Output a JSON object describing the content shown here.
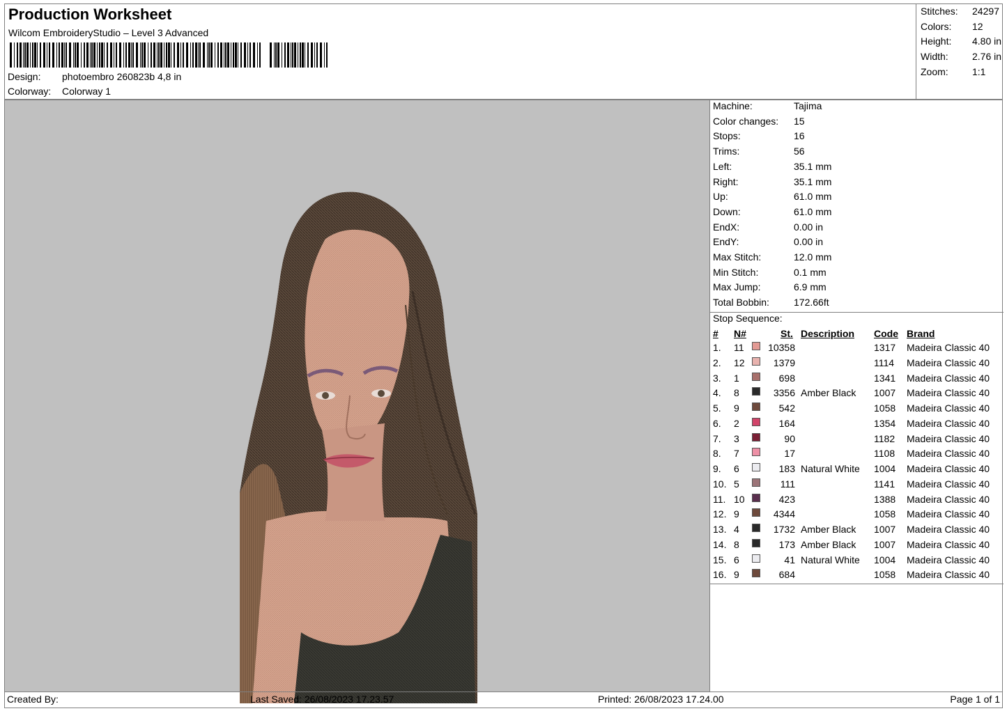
{
  "header": {
    "title": "Production Worksheet",
    "subtitle": "Wilcom EmbroideryStudio – Level 3 Advanced",
    "design_label": "Design:",
    "design_value": "photoembro 260823b 4,8 in",
    "colorway_label": "Colorway:",
    "colorway_value": "Colorway 1"
  },
  "summary": [
    {
      "label": "Stitches:",
      "value": "24297"
    },
    {
      "label": "Colors:",
      "value": "12"
    },
    {
      "label": "Height:",
      "value": "4.80 in"
    },
    {
      "label": "Width:",
      "value": "2.76 in"
    },
    {
      "label": "Zoom:",
      "value": "1:1"
    }
  ],
  "machine_info": [
    {
      "label": "Machine:",
      "value": "Tajima"
    },
    {
      "label": "Color changes:",
      "value": "15"
    },
    {
      "label": "Stops:",
      "value": "16"
    },
    {
      "label": "Trims:",
      "value": "56"
    },
    {
      "label": "Left:",
      "value": "35.1 mm"
    },
    {
      "label": "Right:",
      "value": "35.1 mm"
    },
    {
      "label": "Up:",
      "value": "61.0 mm"
    },
    {
      "label": "Down:",
      "value": "61.0 mm"
    },
    {
      "label": "EndX:",
      "value": "0.00 in"
    },
    {
      "label": "EndY:",
      "value": "0.00 in"
    },
    {
      "label": "Max Stitch:",
      "value": "12.0 mm"
    },
    {
      "label": "Min Stitch:",
      "value": "0.1 mm"
    },
    {
      "label": "Max Jump:",
      "value": "6.9 mm"
    },
    {
      "label": "Total Bobbin:",
      "value": "172.66ft"
    }
  ],
  "stop_sequence": {
    "title": "Stop Sequence:",
    "headers": [
      "#",
      "N#",
      "St.",
      "Description",
      "Code",
      "Brand"
    ],
    "rows": [
      {
        "n": "1.",
        "needle": "11",
        "color": "#e39a94",
        "st": "10358",
        "desc": "",
        "code": "1317",
        "brand": "Madeira Classic 40"
      },
      {
        "n": "2.",
        "needle": "12",
        "color": "#e8b2ae",
        "st": "1379",
        "desc": "",
        "code": "1114",
        "brand": "Madeira Classic 40"
      },
      {
        "n": "3.",
        "needle": "1",
        "color": "#a8706c",
        "st": "698",
        "desc": "",
        "code": "1341",
        "brand": "Madeira Classic 40"
      },
      {
        "n": "4.",
        "needle": "8",
        "color": "#2a2a2a",
        "st": "3356",
        "desc": "Amber Black",
        "code": "1007",
        "brand": "Madeira Classic 40"
      },
      {
        "n": "5.",
        "needle": "9",
        "color": "#6e4a3c",
        "st": "542",
        "desc": "",
        "code": "1058",
        "brand": "Madeira Classic 40"
      },
      {
        "n": "6.",
        "needle": "2",
        "color": "#d2446a",
        "st": "164",
        "desc": "",
        "code": "1354",
        "brand": "Madeira Classic 40"
      },
      {
        "n": "7.",
        "needle": "3",
        "color": "#7a1f35",
        "st": "90",
        "desc": "",
        "code": "1182",
        "brand": "Madeira Classic 40"
      },
      {
        "n": "8.",
        "needle": "7",
        "color": "#ee90a6",
        "st": "17",
        "desc": "",
        "code": "1108",
        "brand": "Madeira Classic 40"
      },
      {
        "n": "9.",
        "needle": "6",
        "color": "#ececf0",
        "st": "183",
        "desc": "Natural White",
        "code": "1004",
        "brand": "Madeira Classic 40"
      },
      {
        "n": "10.",
        "needle": "5",
        "color": "#9c7478",
        "st": "111",
        "desc": "",
        "code": "1141",
        "brand": "Madeira Classic 40"
      },
      {
        "n": "11.",
        "needle": "10",
        "color": "#5a2f4e",
        "st": "423",
        "desc": "",
        "code": "1388",
        "brand": "Madeira Classic 40"
      },
      {
        "n": "12.",
        "needle": "9",
        "color": "#6e4a3c",
        "st": "4344",
        "desc": "",
        "code": "1058",
        "brand": "Madeira Classic 40"
      },
      {
        "n": "13.",
        "needle": "4",
        "color": "#2a2a2a",
        "st": "1732",
        "desc": "Amber Black",
        "code": "1007",
        "brand": "Madeira Classic 40"
      },
      {
        "n": "14.",
        "needle": "8",
        "color": "#2a2a2a",
        "st": "173",
        "desc": "Amber Black",
        "code": "1007",
        "brand": "Madeira Classic 40"
      },
      {
        "n": "15.",
        "needle": "6",
        "color": "#ececf0",
        "st": "41",
        "desc": "Natural White",
        "code": "1004",
        "brand": "Madeira Classic 40"
      },
      {
        "n": "16.",
        "needle": "9",
        "color": "#6e4a3c",
        "st": "684",
        "desc": "",
        "code": "1058",
        "brand": "Madeira Classic 40"
      }
    ]
  },
  "footer": {
    "created_by": "Created By:",
    "last_saved": "Last Saved: 26/08/2023 17.23.57",
    "printed": "Printed: 26/08/2023 17.24.00",
    "page": "Page 1 of 1"
  },
  "colors": {
    "canvas_bg": "#c0c0c0",
    "border": "#7f7f7f"
  }
}
